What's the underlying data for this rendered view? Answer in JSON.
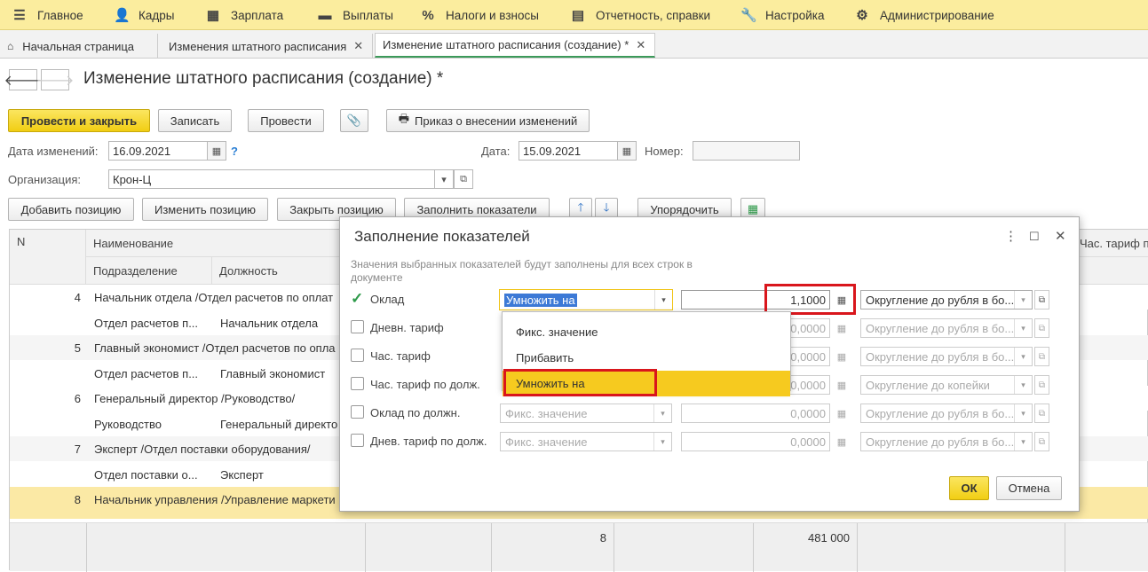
{
  "menu": [
    {
      "label": "Главное",
      "icon": "hamburger-icon"
    },
    {
      "label": "Кадры",
      "icon": "people-icon"
    },
    {
      "label": "Зарплата",
      "icon": "calculator-icon"
    },
    {
      "label": "Выплаты",
      "icon": "wallet-icon"
    },
    {
      "label": "Налоги и взносы",
      "icon": "percent-icon"
    },
    {
      "label": "Отчетность, справки",
      "icon": "report-icon"
    },
    {
      "label": "Настройка",
      "icon": "wrench-icon"
    },
    {
      "label": "Администрирование",
      "icon": "gear-icon"
    }
  ],
  "tabs": [
    {
      "label": "Начальная страница"
    },
    {
      "label": "Изменения штатного расписания"
    },
    {
      "label": "Изменение штатного расписания (создание) *"
    }
  ],
  "page": {
    "title": "Изменение штатного расписания (создание) *"
  },
  "toolbar": {
    "post_close": "Провести и закрыть",
    "save": "Записать",
    "post": "Провести",
    "order": "Приказ о внесении изменений"
  },
  "form": {
    "date_change_label": "Дата изменений:",
    "date_change_value": "16.09.2021",
    "help": "?",
    "date_label": "Дата:",
    "date_value": "15.09.2021",
    "number_label": "Номер:",
    "number_value": "",
    "org_label": "Организация:",
    "org_value": "Крон-Ц"
  },
  "table_toolbar": {
    "add": "Добавить позицию",
    "change": "Изменить позицию",
    "close": "Закрыть позицию",
    "fill": "Заполнить показатели",
    "sort": "Упорядочить"
  },
  "grid": {
    "headers": {
      "n": "N",
      "name": "Наименование",
      "division": "Подразделение",
      "position": "Должность",
      "hour_rate": "Час. тариф п..."
    },
    "rows": [
      {
        "n": "4",
        "name": "Начальник отдела /Отдел расчетов по оплат",
        "division": "Отдел расчетов п...",
        "position": "Начальник отдела"
      },
      {
        "n": "5",
        "name": "Главный экономист /Отдел расчетов по опла",
        "division": "Отдел расчетов п...",
        "position": "Главный экономист"
      },
      {
        "n": "6",
        "name": "Генеральный директор /Руководство/",
        "division": "Руководство",
        "position": "Генеральный директо"
      },
      {
        "n": "7",
        "name": "Эксперт /Отдел поставки оборудования/",
        "division": "Отдел поставки о...",
        "position": "Эксперт"
      },
      {
        "n": "8",
        "name": "Начальник управления /Управление маркети",
        "division": "",
        "position": ""
      }
    ],
    "totals": {
      "count": "8",
      "sum": "481 000"
    }
  },
  "dialog": {
    "title": "Заполнение показателей",
    "hint": "Значения выбранных показателей будут заполнены для всех строк в документе",
    "rows": [
      {
        "label": "Оклад",
        "checked": true,
        "op": "Умножить на",
        "value": "1,1000",
        "rounding": "Округление до рубля в бо..."
      },
      {
        "label": "Дневн. тариф",
        "checked": false,
        "op": "",
        "value": "0,0000",
        "rounding": "Округление до рубля в бо..."
      },
      {
        "label": "Час. тариф",
        "checked": false,
        "op": "",
        "value": "0,0000",
        "rounding": "Округление до рубля в бо..."
      },
      {
        "label": "Час. тариф по долж.",
        "checked": false,
        "op": "",
        "value": "0,0000",
        "rounding": "Округление до копейки"
      },
      {
        "label": "Оклад по должн.",
        "checked": false,
        "op": "Фикс. значение",
        "value": "0,0000",
        "rounding": "Округление до рубля в бо..."
      },
      {
        "label": "Днев. тариф по долж.",
        "checked": false,
        "op": "Фикс. значение",
        "value": "0,0000",
        "rounding": "Округление до рубля в бо..."
      }
    ],
    "dropdown": [
      "Фикс. значение",
      "Прибавить",
      "Умножить на"
    ],
    "ok": "ОК",
    "cancel": "Отмена"
  },
  "colors": {
    "accent": "#f1ce13",
    "highlight_box": "#d9161c",
    "menubar": "#fbed9e",
    "selected_row": "#fbe9a5"
  }
}
